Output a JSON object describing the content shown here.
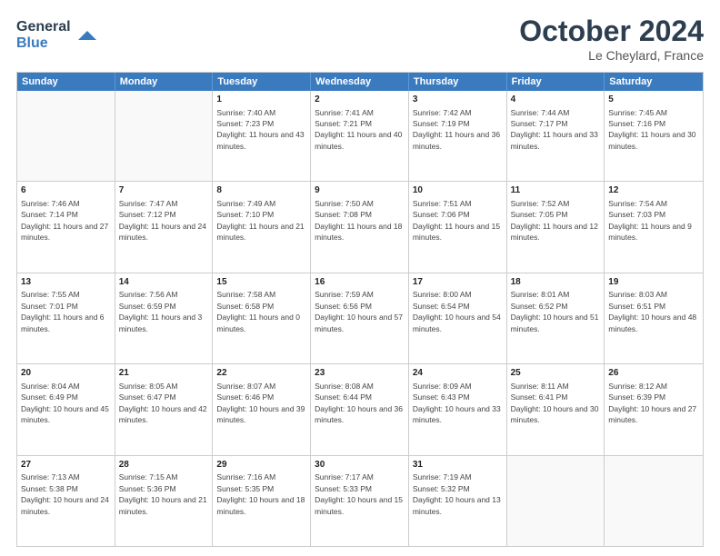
{
  "header": {
    "logo_line1": "General",
    "logo_line2": "Blue",
    "month": "October 2024",
    "location": "Le Cheylard, France"
  },
  "days_of_week": [
    "Sunday",
    "Monday",
    "Tuesday",
    "Wednesday",
    "Thursday",
    "Friday",
    "Saturday"
  ],
  "weeks": [
    [
      {
        "day": "",
        "sunrise": "",
        "sunset": "",
        "daylight": ""
      },
      {
        "day": "",
        "sunrise": "",
        "sunset": "",
        "daylight": ""
      },
      {
        "day": "1",
        "sunrise": "Sunrise: 7:40 AM",
        "sunset": "Sunset: 7:23 PM",
        "daylight": "Daylight: 11 hours and 43 minutes."
      },
      {
        "day": "2",
        "sunrise": "Sunrise: 7:41 AM",
        "sunset": "Sunset: 7:21 PM",
        "daylight": "Daylight: 11 hours and 40 minutes."
      },
      {
        "day": "3",
        "sunrise": "Sunrise: 7:42 AM",
        "sunset": "Sunset: 7:19 PM",
        "daylight": "Daylight: 11 hours and 36 minutes."
      },
      {
        "day": "4",
        "sunrise": "Sunrise: 7:44 AM",
        "sunset": "Sunset: 7:17 PM",
        "daylight": "Daylight: 11 hours and 33 minutes."
      },
      {
        "day": "5",
        "sunrise": "Sunrise: 7:45 AM",
        "sunset": "Sunset: 7:16 PM",
        "daylight": "Daylight: 11 hours and 30 minutes."
      }
    ],
    [
      {
        "day": "6",
        "sunrise": "Sunrise: 7:46 AM",
        "sunset": "Sunset: 7:14 PM",
        "daylight": "Daylight: 11 hours and 27 minutes."
      },
      {
        "day": "7",
        "sunrise": "Sunrise: 7:47 AM",
        "sunset": "Sunset: 7:12 PM",
        "daylight": "Daylight: 11 hours and 24 minutes."
      },
      {
        "day": "8",
        "sunrise": "Sunrise: 7:49 AM",
        "sunset": "Sunset: 7:10 PM",
        "daylight": "Daylight: 11 hours and 21 minutes."
      },
      {
        "day": "9",
        "sunrise": "Sunrise: 7:50 AM",
        "sunset": "Sunset: 7:08 PM",
        "daylight": "Daylight: 11 hours and 18 minutes."
      },
      {
        "day": "10",
        "sunrise": "Sunrise: 7:51 AM",
        "sunset": "Sunset: 7:06 PM",
        "daylight": "Daylight: 11 hours and 15 minutes."
      },
      {
        "day": "11",
        "sunrise": "Sunrise: 7:52 AM",
        "sunset": "Sunset: 7:05 PM",
        "daylight": "Daylight: 11 hours and 12 minutes."
      },
      {
        "day": "12",
        "sunrise": "Sunrise: 7:54 AM",
        "sunset": "Sunset: 7:03 PM",
        "daylight": "Daylight: 11 hours and 9 minutes."
      }
    ],
    [
      {
        "day": "13",
        "sunrise": "Sunrise: 7:55 AM",
        "sunset": "Sunset: 7:01 PM",
        "daylight": "Daylight: 11 hours and 6 minutes."
      },
      {
        "day": "14",
        "sunrise": "Sunrise: 7:56 AM",
        "sunset": "Sunset: 6:59 PM",
        "daylight": "Daylight: 11 hours and 3 minutes."
      },
      {
        "day": "15",
        "sunrise": "Sunrise: 7:58 AM",
        "sunset": "Sunset: 6:58 PM",
        "daylight": "Daylight: 11 hours and 0 minutes."
      },
      {
        "day": "16",
        "sunrise": "Sunrise: 7:59 AM",
        "sunset": "Sunset: 6:56 PM",
        "daylight": "Daylight: 10 hours and 57 minutes."
      },
      {
        "day": "17",
        "sunrise": "Sunrise: 8:00 AM",
        "sunset": "Sunset: 6:54 PM",
        "daylight": "Daylight: 10 hours and 54 minutes."
      },
      {
        "day": "18",
        "sunrise": "Sunrise: 8:01 AM",
        "sunset": "Sunset: 6:52 PM",
        "daylight": "Daylight: 10 hours and 51 minutes."
      },
      {
        "day": "19",
        "sunrise": "Sunrise: 8:03 AM",
        "sunset": "Sunset: 6:51 PM",
        "daylight": "Daylight: 10 hours and 48 minutes."
      }
    ],
    [
      {
        "day": "20",
        "sunrise": "Sunrise: 8:04 AM",
        "sunset": "Sunset: 6:49 PM",
        "daylight": "Daylight: 10 hours and 45 minutes."
      },
      {
        "day": "21",
        "sunrise": "Sunrise: 8:05 AM",
        "sunset": "Sunset: 6:47 PM",
        "daylight": "Daylight: 10 hours and 42 minutes."
      },
      {
        "day": "22",
        "sunrise": "Sunrise: 8:07 AM",
        "sunset": "Sunset: 6:46 PM",
        "daylight": "Daylight: 10 hours and 39 minutes."
      },
      {
        "day": "23",
        "sunrise": "Sunrise: 8:08 AM",
        "sunset": "Sunset: 6:44 PM",
        "daylight": "Daylight: 10 hours and 36 minutes."
      },
      {
        "day": "24",
        "sunrise": "Sunrise: 8:09 AM",
        "sunset": "Sunset: 6:43 PM",
        "daylight": "Daylight: 10 hours and 33 minutes."
      },
      {
        "day": "25",
        "sunrise": "Sunrise: 8:11 AM",
        "sunset": "Sunset: 6:41 PM",
        "daylight": "Daylight: 10 hours and 30 minutes."
      },
      {
        "day": "26",
        "sunrise": "Sunrise: 8:12 AM",
        "sunset": "Sunset: 6:39 PM",
        "daylight": "Daylight: 10 hours and 27 minutes."
      }
    ],
    [
      {
        "day": "27",
        "sunrise": "Sunrise: 7:13 AM",
        "sunset": "Sunset: 5:38 PM",
        "daylight": "Daylight: 10 hours and 24 minutes."
      },
      {
        "day": "28",
        "sunrise": "Sunrise: 7:15 AM",
        "sunset": "Sunset: 5:36 PM",
        "daylight": "Daylight: 10 hours and 21 minutes."
      },
      {
        "day": "29",
        "sunrise": "Sunrise: 7:16 AM",
        "sunset": "Sunset: 5:35 PM",
        "daylight": "Daylight: 10 hours and 18 minutes."
      },
      {
        "day": "30",
        "sunrise": "Sunrise: 7:17 AM",
        "sunset": "Sunset: 5:33 PM",
        "daylight": "Daylight: 10 hours and 15 minutes."
      },
      {
        "day": "31",
        "sunrise": "Sunrise: 7:19 AM",
        "sunset": "Sunset: 5:32 PM",
        "daylight": "Daylight: 10 hours and 13 minutes."
      },
      {
        "day": "",
        "sunrise": "",
        "sunset": "",
        "daylight": ""
      },
      {
        "day": "",
        "sunrise": "",
        "sunset": "",
        "daylight": ""
      }
    ]
  ]
}
